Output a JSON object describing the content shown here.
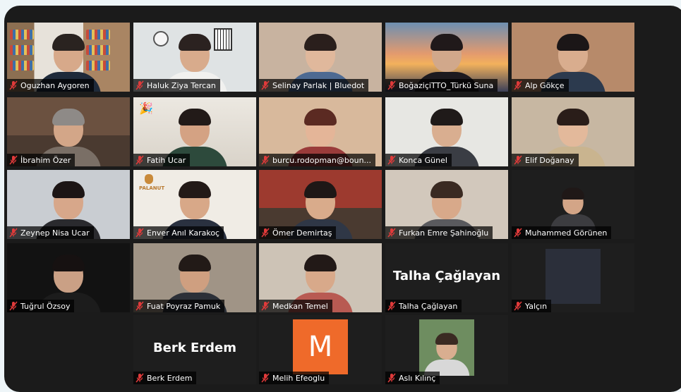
{
  "colors": {
    "background": "#eef5f8",
    "frame": "#1b1b1b",
    "tile": "#232323",
    "active_speaker": "#c7e34a",
    "muted_mic": "#e03a3a",
    "avatar_orange": "#ef6a2a"
  },
  "participants": [
    {
      "name": "Oguzhan Aygoren",
      "muted": true,
      "style": "shelves",
      "bg": "#b9a98e",
      "skin": "#d7a98a",
      "hair": "#2a2320",
      "shirt": "#1f2a3a"
    },
    {
      "name": "Haluk Ziya Tercan",
      "muted": true,
      "active": true,
      "style": "office",
      "bg": "#dfe3e4",
      "skin": "#d8ab8c",
      "hair": "#2b2220",
      "shirt": "#f1f1ef"
    },
    {
      "name": "Selinay Parlak | Bluedot",
      "muted": true,
      "style": "plain",
      "bg": "#c8b3a0",
      "skin": "#e0b89c",
      "hair": "#2a1f1c",
      "shirt": "#4d6a92"
    },
    {
      "name": "BoğaziçiTTO_Türkü Suna",
      "muted": true,
      "style": "sunset",
      "bg": "#e6936d",
      "skin": "#d1a88b",
      "hair": "#20191a",
      "shirt": "#1d1a1f"
    },
    {
      "name": "Alp Gökçe",
      "muted": true,
      "style": "plain",
      "bg": "#b78a6a",
      "skin": "#d9ad8e",
      "hair": "#1b1617",
      "shirt": "#2c3a4e"
    },
    {
      "name": "İbrahim Özer",
      "muted": true,
      "style": "room",
      "bg": "#6b5140",
      "skin": "#d3a688",
      "hair": "#8e8a87",
      "shirt": "#7a6f66"
    },
    {
      "name": "Fatih Ucar",
      "muted": true,
      "style": "party",
      "bg": "#e7e2da",
      "skin": "#d4a283",
      "hair": "#221a18",
      "shirt": "#2d4a3c"
    },
    {
      "name": "burcu.rodopman@boun...",
      "muted": true,
      "style": "plain",
      "bg": "#d8b99c",
      "skin": "#e4b598",
      "hair": "#5b2a22",
      "shirt": "#9a3b3a"
    },
    {
      "name": "Konca Günel",
      "muted": true,
      "style": "plain",
      "bg": "#e7e7e3",
      "skin": "#d9ae90",
      "hair": "#1f1a19",
      "shirt": "#3a3d44"
    },
    {
      "name": "Elif Doğanay",
      "muted": true,
      "style": "plain",
      "bg": "#c7b7a2",
      "skin": "#e3b99b",
      "hair": "#2a1d19",
      "shirt": "#c9b48f"
    },
    {
      "name": "Zeynep Nisa Ucar",
      "muted": true,
      "style": "plain",
      "bg": "#c9cdd2",
      "skin": "#d7a78a",
      "hair": "#1c1515",
      "shirt": "#2a2a2e"
    },
    {
      "name": "Enver Anıl Karakoç",
      "muted": true,
      "style": "logo",
      "bg": "#f0ece5",
      "skin": "#d8a888",
      "hair": "#231a17",
      "shirt": "#2a3140",
      "logo": "PALANUT"
    },
    {
      "name": "Ömer Demirtaş",
      "muted": true,
      "style": "room",
      "bg": "#9d3a2f",
      "skin": "#d9ab8b",
      "hair": "#1e1716",
      "shirt": "#2f3746"
    },
    {
      "name": "Furkan Emre Şahinoğlu",
      "muted": true,
      "style": "plain",
      "bg": "#d2c8bc",
      "skin": "#d8a98a",
      "hair": "#3a2a22",
      "shirt": "#5a5a5e"
    },
    {
      "name": "Muhammed Görünen",
      "muted": true,
      "style": "small",
      "bg": "#1e1e1e",
      "skin": "#d3a587",
      "hair": "#1f1817",
      "shirt": "#3c3c40"
    },
    {
      "name": "Tuğrul Özsoy",
      "muted": true,
      "style": "dark",
      "bg": "#121212",
      "skin": "#caa085",
      "hair": "#161111",
      "shirt": "#1c1c1c"
    },
    {
      "name": "Fuat Poyraz Pamuk",
      "muted": true,
      "style": "plain",
      "bg": "#a09486",
      "skin": "#cf9f80",
      "hair": "#221a17",
      "shirt": "#2c3038"
    },
    {
      "name": "Medkan Temel",
      "muted": true,
      "style": "plain",
      "bg": "#cdc3b6",
      "skin": "#d8a98a",
      "hair": "#221917",
      "shirt": "#b85a52"
    },
    {
      "name": "Talha Çağlayan",
      "muted": true,
      "style": "text",
      "display": "Talha Çağlayan"
    },
    {
      "name": "Yalçın",
      "muted": true,
      "style": "box"
    },
    {
      "name": "Berk Erdem",
      "muted": true,
      "style": "text",
      "display": "Berk Erdem"
    },
    {
      "name": "Melih Efeoglu",
      "muted": true,
      "style": "avatar",
      "initial": "M"
    },
    {
      "name": "Aslı Kılınç",
      "muted": true,
      "style": "small",
      "bg": "#6e8d60",
      "skin": "#d9ae90",
      "hair": "#3a2a22",
      "shirt": "#d8d8d8"
    }
  ]
}
